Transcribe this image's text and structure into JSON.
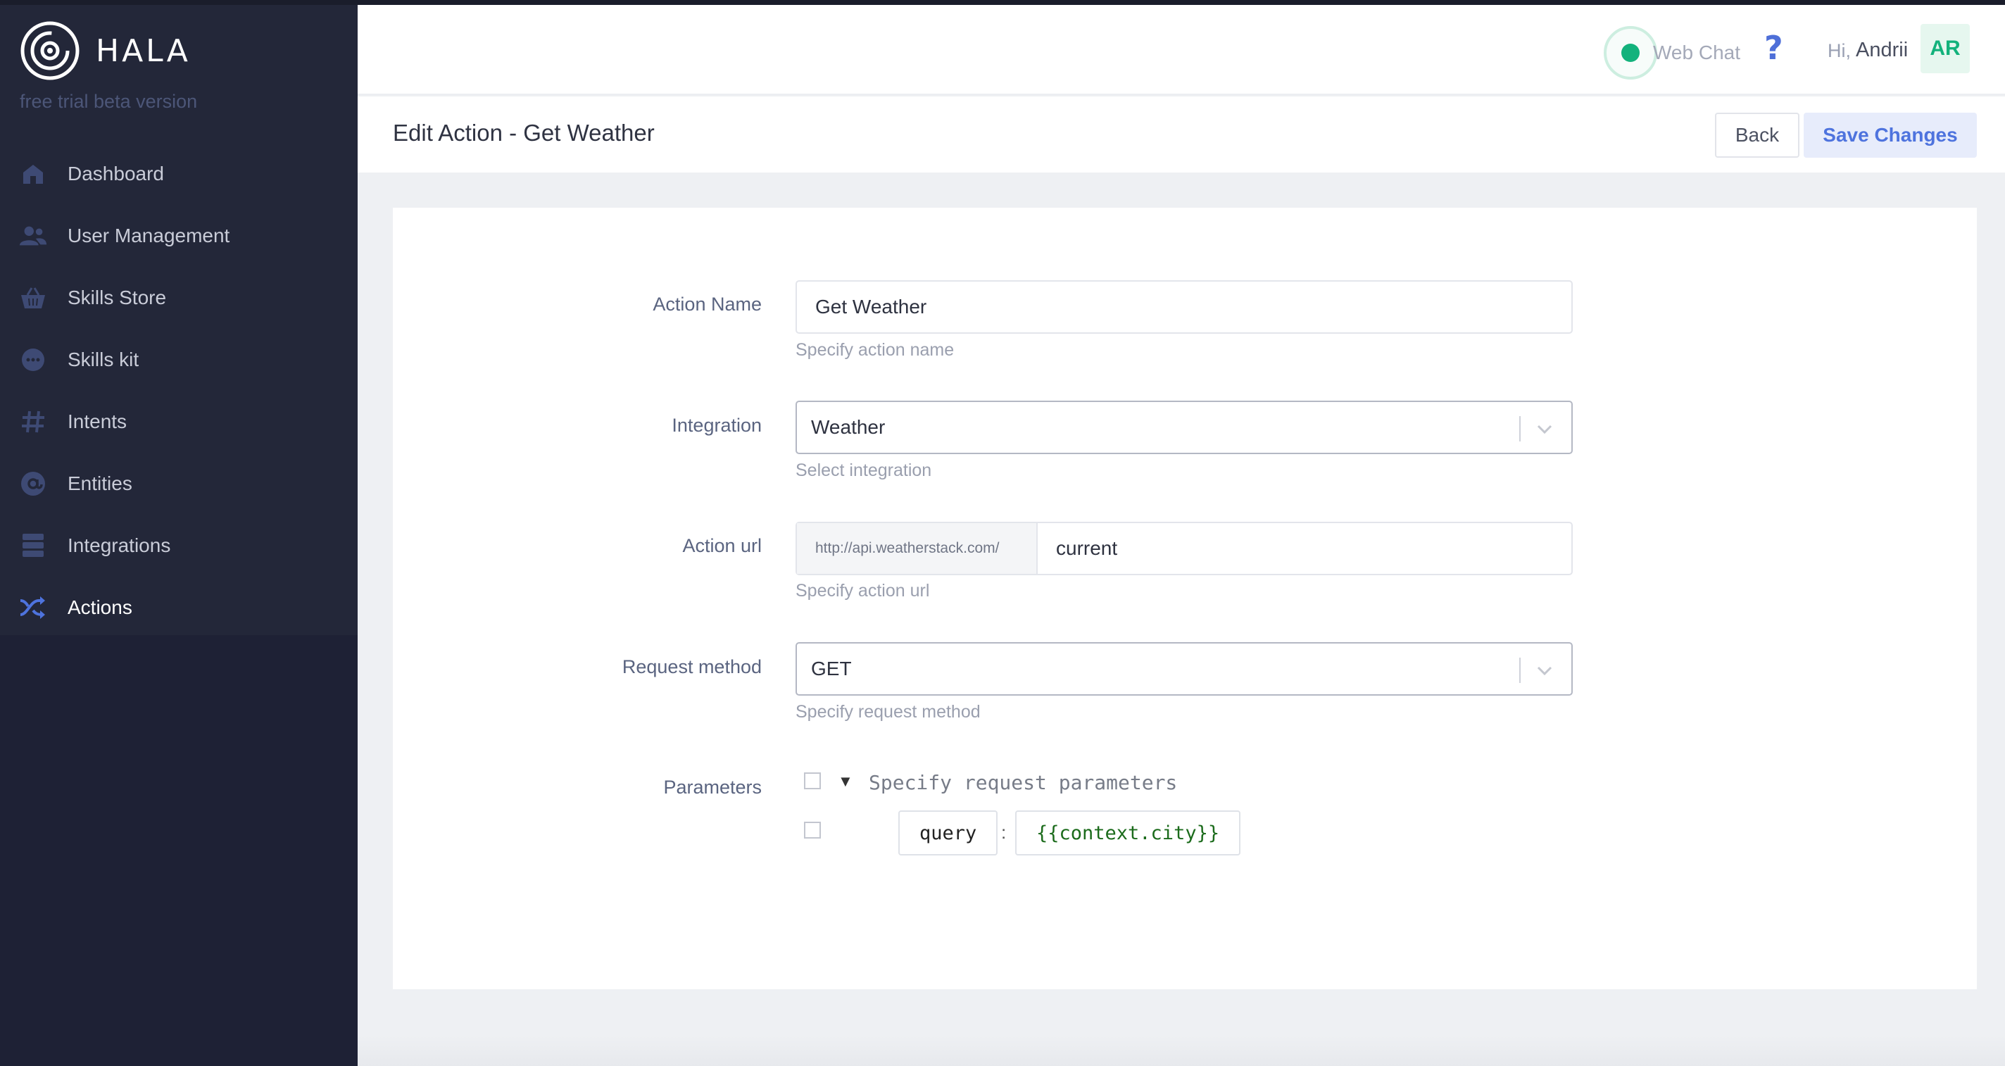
{
  "app": {
    "name": "HALA",
    "subtitle": "free trial beta version"
  },
  "sidebar": {
    "items": [
      {
        "label": "Dashboard",
        "icon": "home-icon",
        "active": false
      },
      {
        "label": "User Management",
        "icon": "users-icon",
        "active": false
      },
      {
        "label": "Skills Store",
        "icon": "basket-icon",
        "active": false
      },
      {
        "label": "Skills kit",
        "icon": "chat-bubble-icon",
        "active": false
      },
      {
        "label": "Intents",
        "icon": "hash-icon",
        "active": false
      },
      {
        "label": "Entities",
        "icon": "at-icon",
        "active": false
      },
      {
        "label": "Integrations",
        "icon": "server-icon",
        "active": false
      },
      {
        "label": "Actions",
        "icon": "shuffle-icon",
        "active": true
      }
    ]
  },
  "header": {
    "webchat_label": "Web Chat",
    "help_symbol": "?",
    "greeting": "Hi,",
    "user_name": "Andrii",
    "avatar_initials": "AR"
  },
  "page": {
    "title": "Edit Action - Get Weather",
    "back_label": "Back",
    "save_label": "Save Changes"
  },
  "form": {
    "action_name": {
      "label": "Action Name",
      "value": "Get Weather",
      "help": "Specify action name"
    },
    "integration": {
      "label": "Integration",
      "value": "Weather",
      "help": "Select integration"
    },
    "action_url": {
      "label": "Action url",
      "prefix": "http://api.weatherstack.com/",
      "value": "current",
      "help": "Specify action url"
    },
    "request_method": {
      "label": "Request method",
      "value": "GET",
      "help": "Specify request method"
    },
    "parameters": {
      "label": "Parameters",
      "header": "Specify request parameters",
      "entries": [
        {
          "key": "query",
          "separator": ":",
          "value": "{{context.city}}"
        }
      ]
    }
  },
  "colors": {
    "sidebar_bg": "#1e2135",
    "accent_blue": "#4e73de",
    "accent_green": "#13b27c"
  }
}
